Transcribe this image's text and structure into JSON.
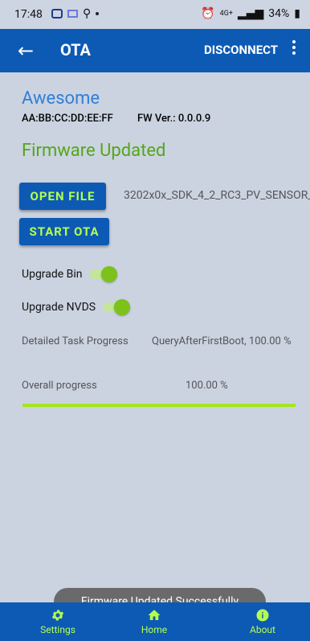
{
  "status_bar": {
    "time": "17:48",
    "network": "4G+",
    "battery": "34%",
    "icons": [
      "photo-icon",
      "message-icon",
      "signal-icon",
      "dot-icon",
      "alarm-icon",
      "wifi-icon",
      "signal-bars-icon",
      "battery-icon"
    ]
  },
  "app_bar": {
    "title": "OTA",
    "disconnect_label": "DISCONNECT",
    "back_icon": "arrow-left-icon",
    "menu_icon": "more-vert-icon"
  },
  "device": {
    "name": "Awesome",
    "mac": "AA:BB:CC:DD:EE:FF",
    "fw_version": "FW Ver.: 0.0.0.9"
  },
  "firmware_status": "Firmware Updated",
  "actions": {
    "open_file_label": "OPEN FILE",
    "start_ota_label": "START OTA",
    "filename": "3202x0x_SDK_4_2_RC3_PV_SENSOR_"
  },
  "toggles": [
    {
      "label": "Upgrade Bin",
      "on": true
    },
    {
      "label": "Upgrade NVDS",
      "on": true
    }
  ],
  "progress": {
    "task_label": "Detailed Task Progress",
    "task_value": "QueryAfterFirstBoot, 100.00 %",
    "overall_label": "Overall progress",
    "overall_value": "100.00 %",
    "overall_fraction": 1.0
  },
  "toast": "Firmware Updated Successfully",
  "bottom_nav": [
    {
      "label": "Settings",
      "icon": "gear-icon"
    },
    {
      "label": "Home",
      "icon": "home-icon"
    },
    {
      "label": "About",
      "icon": "info-icon"
    }
  ],
  "colors": {
    "primary": "#0d5ab5",
    "accent": "#b4ff4c",
    "success": "#55a61a",
    "device_name": "#2f7fd8"
  }
}
